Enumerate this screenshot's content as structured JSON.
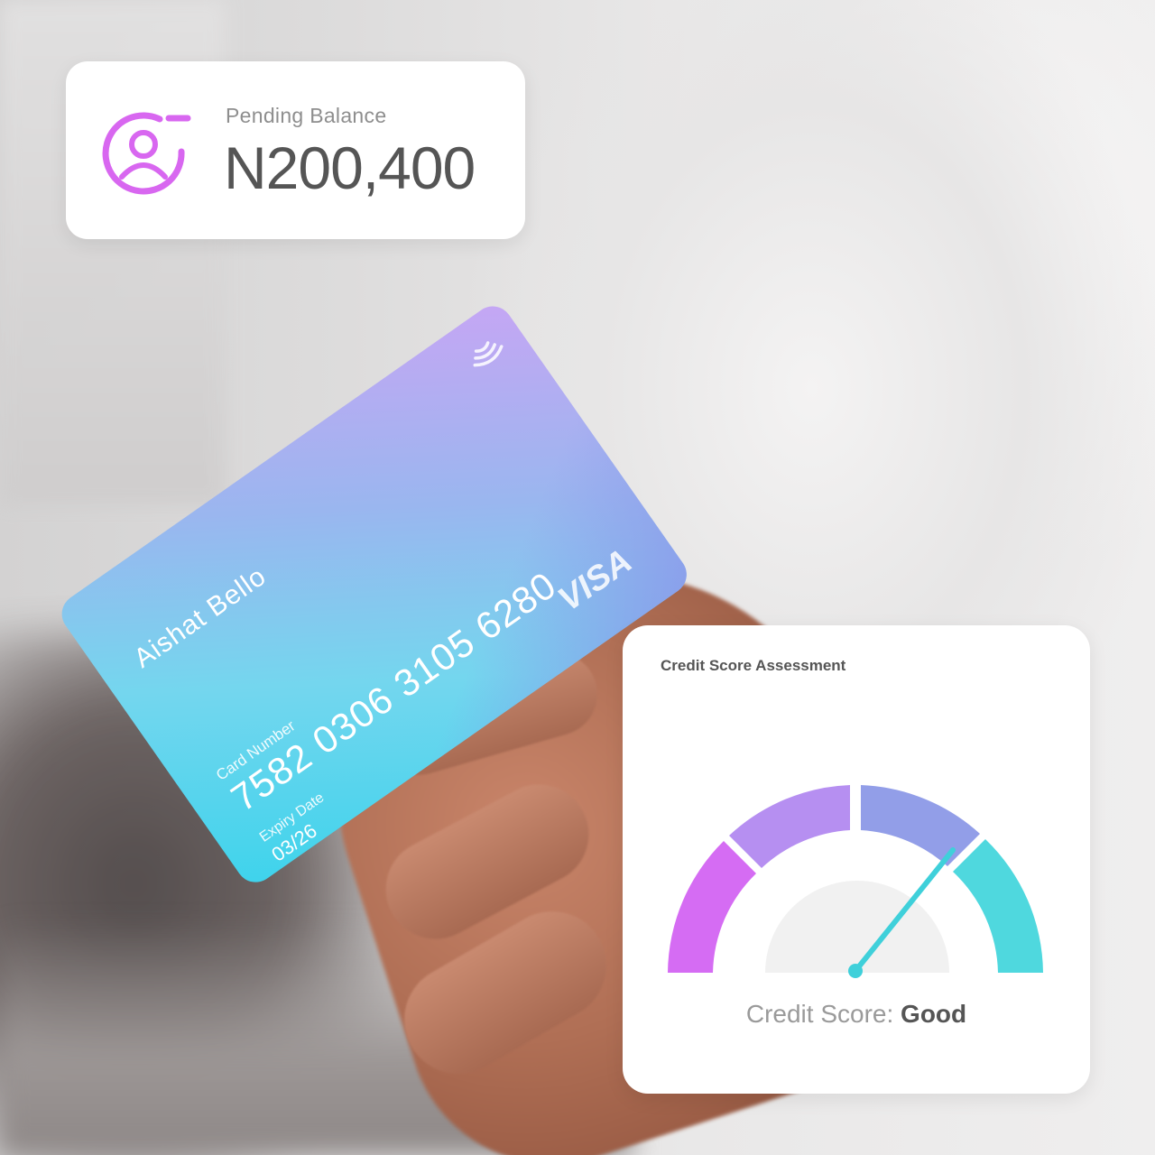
{
  "balance": {
    "label": "Pending Balance",
    "value": "N200,400",
    "icon": "user-profile-icon",
    "icon_color": "#d867f0"
  },
  "card": {
    "holder_name": "Aishat Bello",
    "number_label": "Card Number",
    "number": "7582 0306 3105 6280",
    "expiry_label": "Expiry Date",
    "expiry": "03/26",
    "brand": "VISA",
    "contactless_icon": "contactless-icon",
    "gradient_colors": [
      "#3dd3ec",
      "#74d6ee",
      "#9ab6ef",
      "#c6a6f4",
      "#8c95ea"
    ]
  },
  "credit_score": {
    "title": "Credit Score Assessment",
    "label": "Credit Score:",
    "value": "Good",
    "segment_colors": [
      "#d56cf3",
      "#b68ff1",
      "#929ee8",
      "#4fd8de"
    ],
    "needle_color": "#3fd0da"
  }
}
